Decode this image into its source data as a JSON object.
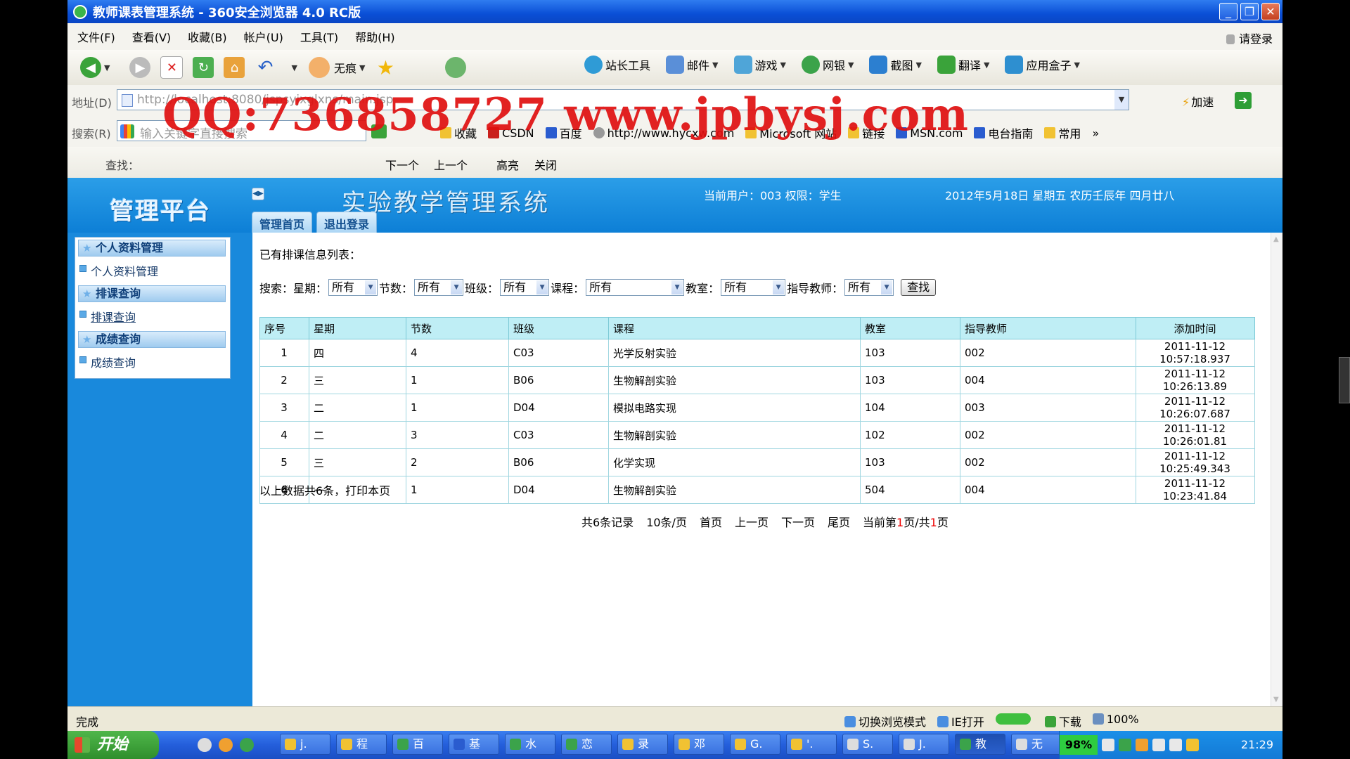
{
  "window": {
    "title": "教师课表管理系统 - 360安全浏览器 4.0 RC版",
    "controls": [
      "_",
      "❐",
      "✕"
    ]
  },
  "menu": {
    "items": [
      "文件(F)",
      "查看(V)",
      "收藏(B)",
      "帐户(U)",
      "工具(T)",
      "帮助(H)"
    ],
    "login": "请登录"
  },
  "toolbar": {
    "no_trace": "无痕",
    "tools": [
      "站长工具",
      "邮件",
      "游戏",
      "网银",
      "截图",
      "翻译",
      "应用盒子"
    ]
  },
  "address": {
    "label": "地址(D)",
    "url": "http://localhost:8080/jspsyjxglxns/main.jsp",
    "accelerate": "加速"
  },
  "searchbar": {
    "label": "搜索(R)",
    "placeholder": "输入关键字直接搜索",
    "favorites": [
      "收藏",
      "CSDN",
      "百度",
      "http://www.hycxw.com",
      "Microsoft 网站",
      "链接",
      "MSN.com",
      "电台指南",
      "常用",
      "»"
    ]
  },
  "watermark": "QQ:736858727 www.jpbysj.com",
  "findbar": {
    "label": "查找：",
    "next": "下一个",
    "prev": "上一个",
    "highlight": "高亮",
    "close": "关闭"
  },
  "header": {
    "brand": "管理平台",
    "system_title": "实验教学管理系统",
    "current_user": "当前用户：003  权限：学生",
    "date": "2012年5月18日 星期五 农历壬辰年 四月廿八",
    "nav_home": "管理首页",
    "nav_logout": "退出登录"
  },
  "sidebar": {
    "sections": [
      {
        "head": "个人资料管理",
        "item": "个人资料管理"
      },
      {
        "head": "排课查询",
        "item": "排课查询"
      },
      {
        "head": "成绩查询",
        "item": "成绩查询"
      }
    ]
  },
  "main": {
    "list_title": "已有排课信息列表：",
    "filters": {
      "search_label": "搜索：",
      "weekday_label": "星期：",
      "weekday_value": "所有",
      "period_label": "节数：",
      "period_value": "所有",
      "class_label": "班级：",
      "class_value": "所有",
      "course_label": "课程：",
      "course_value": "所有",
      "room_label": "教室：",
      "room_value": "所有",
      "teacher_label": "指导教师：",
      "teacher_value": "所有",
      "find_button": "查找"
    },
    "table": {
      "headers": [
        "序号",
        "星期",
        "节数",
        "班级",
        "课程",
        "教室",
        "指导教师",
        "添加时间"
      ],
      "rows": [
        [
          "1",
          "四",
          "4",
          "C03",
          "光学反射实验",
          "103",
          "002",
          "2011-11-12 10:57:18.937"
        ],
        [
          "2",
          "三",
          "1",
          "B06",
          "生物解剖实验",
          "103",
          "004",
          "2011-11-12 10:26:13.89"
        ],
        [
          "3",
          "二",
          "1",
          "D04",
          "模拟电路实现",
          "104",
          "003",
          "2011-11-12 10:26:07.687"
        ],
        [
          "4",
          "二",
          "3",
          "C03",
          "生物解剖实验",
          "102",
          "002",
          "2011-11-12 10:26:01.81"
        ],
        [
          "5",
          "三",
          "2",
          "B06",
          "化学实现",
          "103",
          "002",
          "2011-11-12 10:25:49.343"
        ],
        [
          "6",
          "一",
          "1",
          "D04",
          "生物解剖实验",
          "504",
          "004",
          "2011-11-12 10:23:41.84"
        ]
      ]
    },
    "summary": "以上数据共6条，打印本页",
    "pager": {
      "total": "共6条记录",
      "per_page": "10条/页",
      "first": "首页",
      "prev": "上一页",
      "next": "下一页",
      "last": "尾页",
      "current_prefix": "当前第",
      "current_page": "1",
      "current_mid": "页/共",
      "total_pages": "1",
      "current_suffix": "页"
    }
  },
  "status": {
    "left": "完成",
    "switch_mode": "切换浏览模式",
    "ie_open": "IE打开",
    "download": "下载",
    "zoom": "100%"
  },
  "taskbar": {
    "start": "开始",
    "tasks": [
      "j.",
      "程",
      "百",
      "基",
      "水",
      "恋",
      "录",
      "邓",
      "G.",
      "'.",
      "S.",
      "J.",
      "教",
      "无"
    ],
    "battery": "98%",
    "clock": "21:29"
  },
  "colors": {
    "header_blue": "#0d7fd6",
    "watermark_red": "#e01010",
    "table_header": "#bfeef5"
  }
}
